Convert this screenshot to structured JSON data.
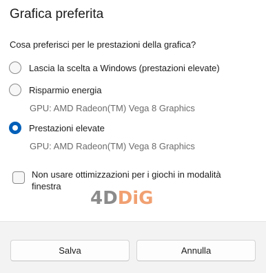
{
  "dialog": {
    "title": "Grafica preferita",
    "question": "Cosa preferisci per le prestazioni della grafica?",
    "options": [
      {
        "label": "Lascia la scelta a Windows (prestazioni elevate)",
        "checked": false
      },
      {
        "label": "Risparmio energia",
        "note": "GPU: AMD Radeon(TM) Vega 8 Graphics",
        "checked": false
      },
      {
        "label": "Prestazioni elevate",
        "note": "GPU: AMD Radeon(TM) Vega 8 Graphics",
        "checked": true
      }
    ],
    "checkbox": {
      "label": "Non usare ottimizzazioni per i giochi in modalità finestra",
      "checked": false
    },
    "watermark": {
      "part1": "4D",
      "part2": "DiG"
    },
    "buttons": {
      "save": "Salva",
      "cancel": "Annulla"
    },
    "accent_color": "#005fb8"
  }
}
